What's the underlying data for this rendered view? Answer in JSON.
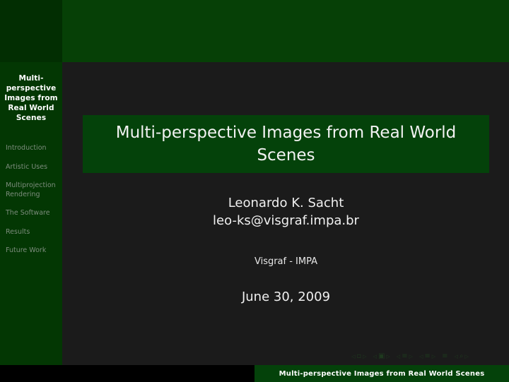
{
  "slide": {
    "theme_colors": {
      "header_green": "#064006",
      "sidebar_green": "#033703",
      "block_green": "#04420a",
      "body_dark": "#1b1b1b",
      "footer_black": "#000000",
      "nav_inactive": "#7c8c7c",
      "text_light": "#f0f0f0"
    }
  },
  "sidebar": {
    "title": "Multi-perspective Images from Real World Scenes",
    "items": [
      {
        "label": "Introduction"
      },
      {
        "label": "Artistic Uses"
      },
      {
        "label": "Multiprojection Rendering"
      },
      {
        "label": "The Software"
      },
      {
        "label": "Results"
      },
      {
        "label": "Future Work"
      }
    ]
  },
  "main": {
    "title": "Multi-perspective Images from Real World Scenes",
    "author_name": "Leonardo K. Sacht",
    "author_email": "leo-ks@visgraf.impa.br",
    "institute": "Visgraf - IMPA",
    "date": "June 30, 2009"
  },
  "navigation_symbols": [
    {
      "name": "slide-icon",
      "glyph": "▫"
    },
    {
      "name": "frame-icon",
      "glyph": "▣"
    },
    {
      "name": "subsection-icon",
      "glyph": "≡"
    },
    {
      "name": "section-icon",
      "glyph": "≡"
    },
    {
      "name": "presentation-icon",
      "glyph": "≡"
    },
    {
      "name": "back-icon",
      "glyph": "◁"
    },
    {
      "name": "search-icon",
      "glyph": "⌕"
    },
    {
      "name": "forward-icon",
      "glyph": "▷"
    }
  ],
  "footer": {
    "text": "Multi-perspective Images from Real World Scenes"
  }
}
